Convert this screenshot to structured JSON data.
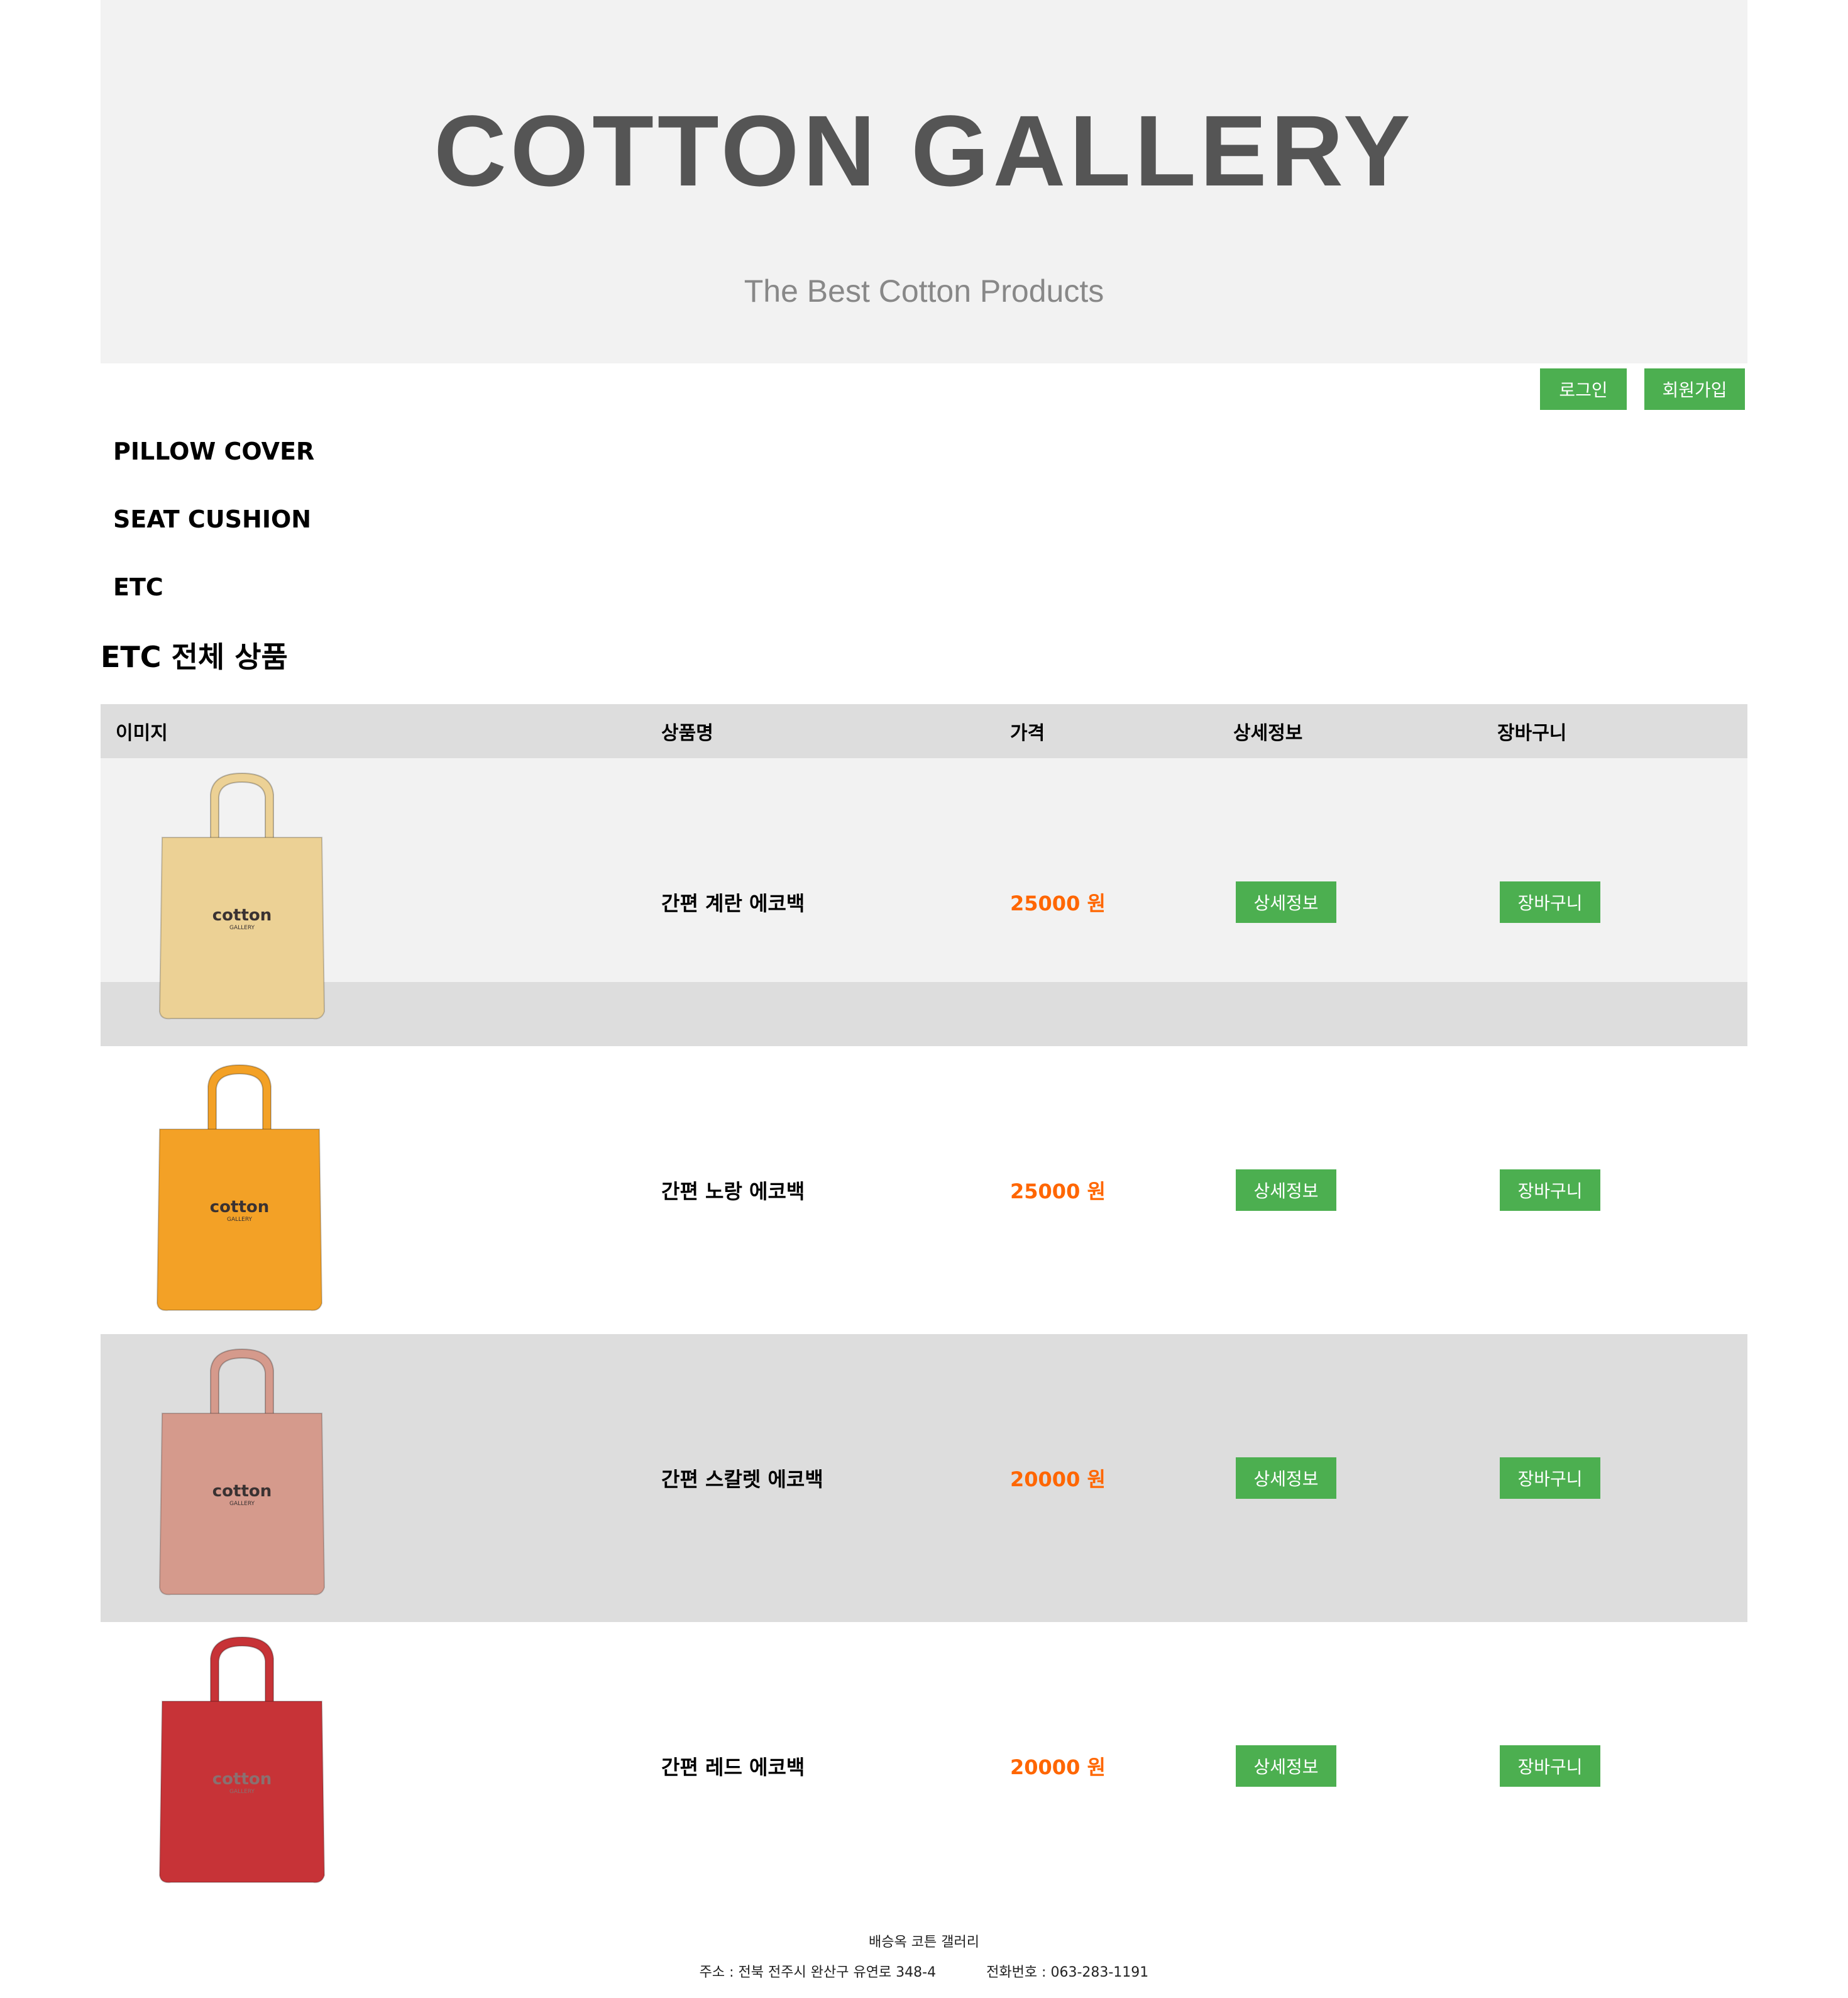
{
  "header": {
    "title": "COTTON GALLERY",
    "subtitle": "The Best Cotton Products"
  },
  "auth": {
    "login_label": "로그인",
    "signup_label": "회원가입"
  },
  "categories": [
    {
      "label": "PILLOW COVER"
    },
    {
      "label": "SEAT CUSHION"
    },
    {
      "label": "ETC"
    }
  ],
  "section_title": "ETC 전체 상품",
  "table": {
    "headers": [
      "이미지",
      "상품명",
      "가격",
      "상세정보",
      "장바구니"
    ],
    "rows": [
      {
        "name": "간편 계란 에코백",
        "price": "25000 원",
        "detail_label": "상세정보",
        "cart_label": "장바구니",
        "bag_color": "#ecd195",
        "logo": "cotton",
        "sub_logo": "GALLERY"
      },
      {
        "name": "간편 노랑 에코백",
        "price": "25000 원",
        "detail_label": "상세정보",
        "cart_label": "장바구니",
        "bag_color": "#f3a126",
        "logo": "cotton",
        "sub_logo": "GALLERY"
      },
      {
        "name": "간편 스칼렛 에코백",
        "price": "20000 원",
        "detail_label": "상세정보",
        "cart_label": "장바구니",
        "bag_color": "#d59a8c",
        "logo": "cotton",
        "sub_logo": "GALLERY"
      },
      {
        "name": "간편 레드 에코백",
        "price": "20000 원",
        "detail_label": "상세정보",
        "cart_label": "장바구니",
        "bag_color": "#c73337",
        "logo": "cotton",
        "sub_logo": "GALLERY"
      }
    ]
  },
  "footer": {
    "company": "배승옥 코튼 갤러리",
    "address": "주소 : 전북 전주시 완산구 유연로 348-4",
    "phone": "전화번호 : 063-283-1191"
  },
  "colors": {
    "accent_button": "#4caf50",
    "price": "#ff6600",
    "hero_bg": "#f2f2f2",
    "header_row_bg": "#dddddd"
  }
}
